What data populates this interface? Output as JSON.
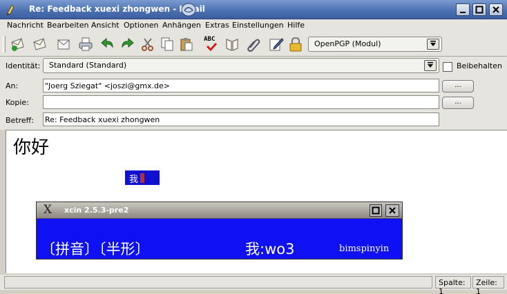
{
  "window": {
    "title": "Re: Feedback xuexi zhongwen - KMail"
  },
  "menubar": [
    "Nachricht",
    "Bearbeiten",
    "Ansicht",
    "Optionen",
    "Anhängen",
    "Extras",
    "Einstellungen",
    "Hilfe"
  ],
  "toolbar": {
    "spellcheck_text": "ABC",
    "crypto_select": "OpenPGP (Modul)"
  },
  "headers": {
    "identity_label": "Identität:",
    "identity_value": "Standard (Standard)",
    "keep_label": "Beibehalten",
    "to_label": "An:",
    "to_value": "\"Joerg Sziegat\" <joszi@gmx.de>",
    "cc_label": "Kopie:",
    "cc_value": "",
    "subject_label": "Betreff:",
    "subject_value": "Re: Feedback xuexi zhongwen",
    "browse_button": "..."
  },
  "editor": {
    "body_text": "你好",
    "preedit_text": "我"
  },
  "xcin": {
    "title": "xcin 2.5.3-pre2",
    "mode": "〔拼音〕〔半形〕",
    "candidate": "我:wo3",
    "method": "bimspinyin"
  },
  "status": {
    "column": "Spalte: 1",
    "line": "Zeile: 1"
  },
  "colors": {
    "titlebar": "#4a6fb0",
    "xcin_bg": "#1010f4",
    "preedit_bg": "#1010d0"
  }
}
